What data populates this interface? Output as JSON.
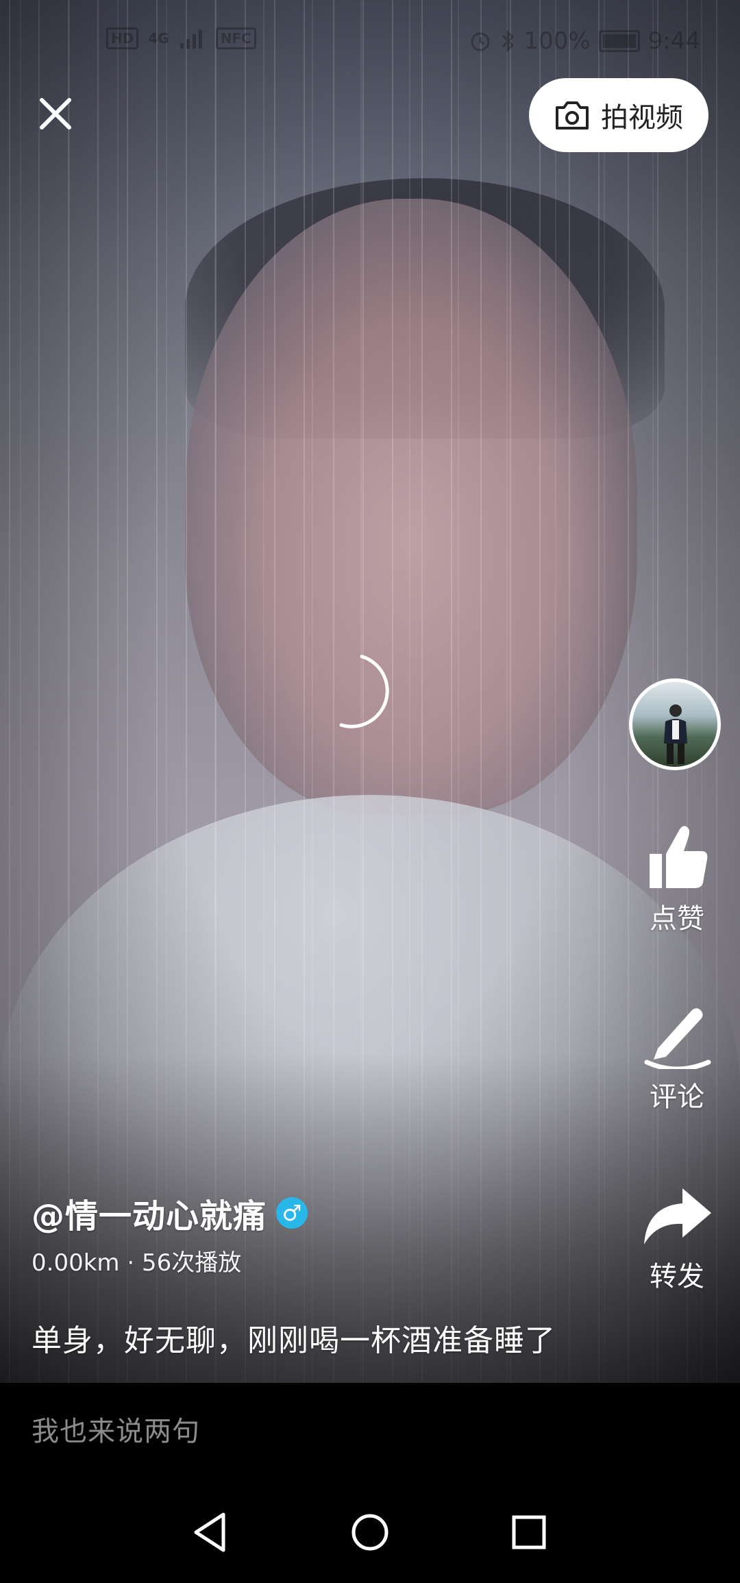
{
  "status_bar": {
    "hd": "HD",
    "network": "4G",
    "nfc": "NFC",
    "battery_percent": "100%",
    "time": "9:44",
    "icons": [
      "alarm-icon",
      "bluetooth-icon",
      "battery-icon"
    ]
  },
  "top_bar": {
    "close_icon": "close-icon",
    "record_button_label": "拍视频",
    "record_icon": "camera-icon"
  },
  "actions": {
    "like_label": "点赞",
    "comment_label": "评论",
    "share_label": "转发"
  },
  "video_info": {
    "username": "@情一动心就痛",
    "gender_symbol": "♂",
    "stats": "0.00km · 56次播放",
    "caption": "单身，好无聊，刚刚喝一杯酒准备睡了"
  },
  "comment_bar": {
    "placeholder": "我也来说两句"
  },
  "nav": {
    "icons": [
      "back-icon",
      "home-icon",
      "recents-icon"
    ]
  },
  "colors": {
    "gender_badge": "#29b6e8",
    "record_button_bg": "#ffffff",
    "comment_bar_bg": "#000000"
  }
}
